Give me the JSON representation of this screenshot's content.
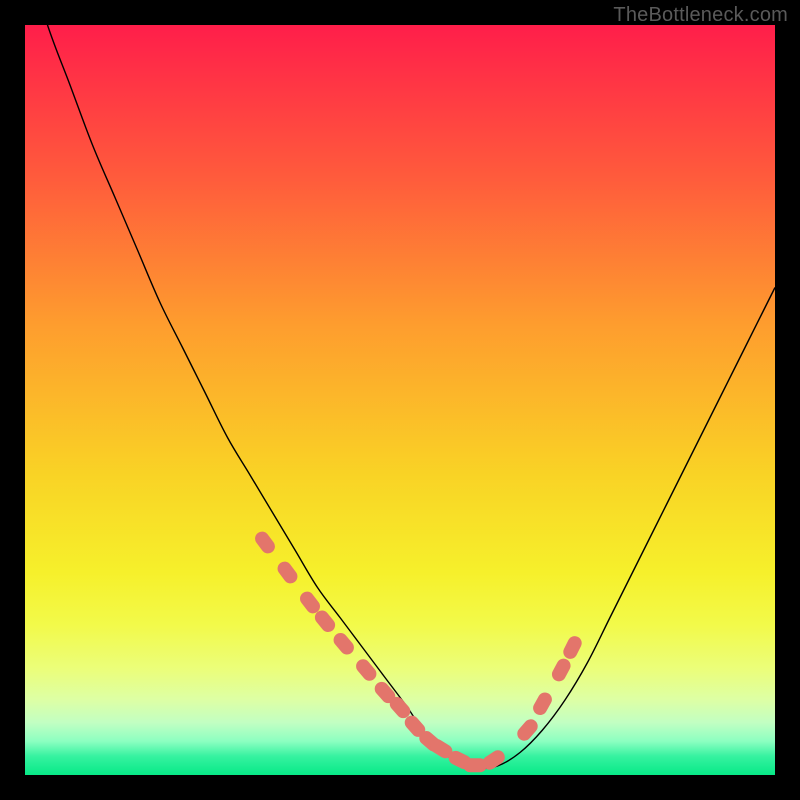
{
  "watermark": "TheBottleneck.com",
  "chart_data": {
    "type": "line",
    "title": "",
    "xlabel": "",
    "ylabel": "",
    "xlim": [
      0,
      100
    ],
    "ylim": [
      0,
      100
    ],
    "grid": false,
    "series": [
      {
        "name": "curve",
        "color": "#000000",
        "stroke_width": 1.4,
        "x": [
          0,
          3,
          6,
          9,
          12,
          15,
          18,
          21,
          24,
          27,
          30,
          33,
          36,
          39,
          42,
          45,
          48,
          51,
          53,
          55,
          57,
          59,
          60,
          63,
          66,
          69,
          72,
          75,
          78,
          81,
          84,
          87,
          90,
          93,
          96,
          100
        ],
        "values": [
          110,
          100,
          92,
          84,
          77,
          70,
          63,
          57,
          51,
          45,
          40,
          35,
          30,
          25,
          21,
          17,
          13,
          9,
          6,
          4,
          2,
          1,
          0.8,
          1.2,
          3,
          6,
          10,
          15,
          21,
          27,
          33,
          39,
          45,
          51,
          57,
          65
        ]
      },
      {
        "name": "marker-band",
        "color": "#E3756B",
        "marker_shape": "rounded-rect",
        "marker_size": 14,
        "x": [
          32,
          35,
          38,
          40,
          42.5,
          45.5,
          48,
          50,
          52,
          54,
          55.5,
          58,
          60,
          62.5,
          67,
          69,
          71.5,
          73
        ],
        "values": [
          31,
          27,
          23,
          20.5,
          17.5,
          14,
          11,
          9,
          6.5,
          4.5,
          3.5,
          2,
          1.3,
          2,
          6,
          9.5,
          14,
          17
        ]
      }
    ],
    "background": {
      "type": "linear-gradient",
      "direction": "top-to-bottom",
      "stops": [
        {
          "offset": 0.0,
          "color": "#FF1E4A"
        },
        {
          "offset": 0.2,
          "color": "#FF5A3C"
        },
        {
          "offset": 0.4,
          "color": "#FE9D2E"
        },
        {
          "offset": 0.6,
          "color": "#F9D325"
        },
        {
          "offset": 0.73,
          "color": "#F6F02B"
        },
        {
          "offset": 0.8,
          "color": "#F2FA4A"
        },
        {
          "offset": 0.86,
          "color": "#EBFE7B"
        },
        {
          "offset": 0.9,
          "color": "#DDFFA5"
        },
        {
          "offset": 0.93,
          "color": "#C2FFC2"
        },
        {
          "offset": 0.955,
          "color": "#8CFFC1"
        },
        {
          "offset": 0.975,
          "color": "#36F2A0"
        },
        {
          "offset": 1.0,
          "color": "#07E987"
        }
      ]
    }
  }
}
